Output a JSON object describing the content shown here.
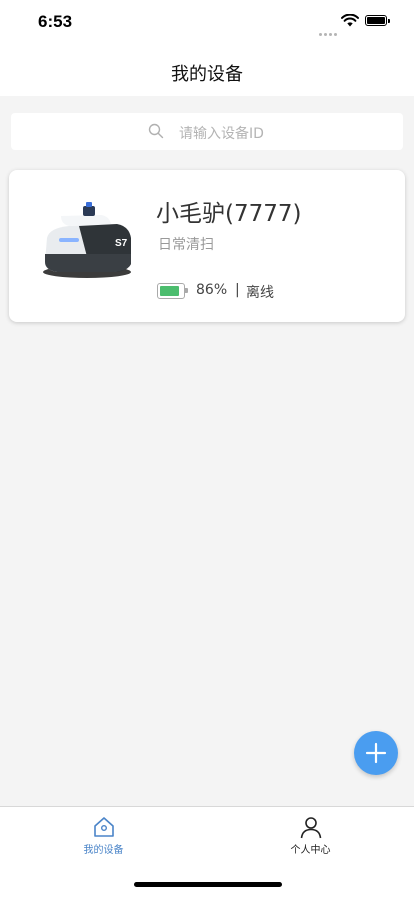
{
  "status_bar": {
    "time": "6:53"
  },
  "nav": {
    "title": "我的设备"
  },
  "search": {
    "placeholder": "请输入设备ID",
    "icon": "search-icon"
  },
  "devices": [
    {
      "name": "小毛驴(7777)",
      "mode": "日常清扫",
      "battery_percent": "86%",
      "battery_level": 0.86,
      "separator": "|",
      "status": "离线",
      "image_icon": "cleaning-robot-image"
    }
  ],
  "fab": {
    "icon": "plus-icon"
  },
  "tab_bar": {
    "tabs": [
      {
        "label": "我的设备",
        "icon": "home-icon",
        "active": true
      },
      {
        "label": "个人中心",
        "icon": "person-icon",
        "active": false
      }
    ]
  },
  "colors": {
    "accent": "#4a9df0",
    "active_tab": "#4a84c8",
    "battery_fill": "#4cbd6e",
    "background": "#f4f4f4"
  }
}
